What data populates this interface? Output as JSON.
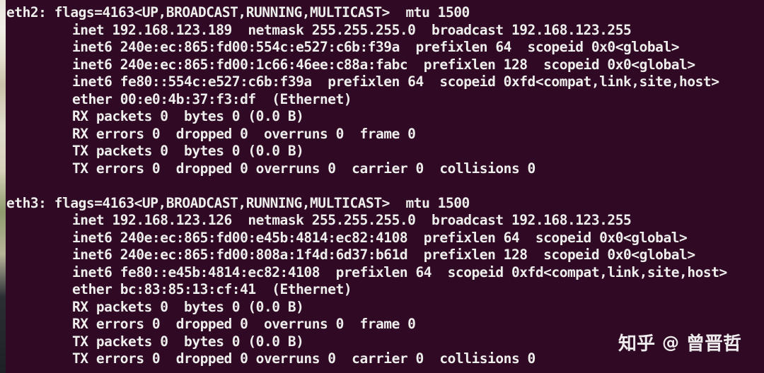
{
  "terminal": {
    "background": "#300a24",
    "foreground": "#eeeeec",
    "eth2": {
      "header": "eth2: flags=4163<UP,BROADCAST,RUNNING,MULTICAST>  mtu 1500",
      "lines": [
        "inet 192.168.123.189  netmask 255.255.255.0  broadcast 192.168.123.255",
        "inet6 240e:ec:865:fd00:554c:e527:c6b:f39a  prefixlen 64  scopeid 0x0<global>",
        "inet6 240e:ec:865:fd00:1c66:46ee:c88a:fabc  prefixlen 128  scopeid 0x0<global>",
        "inet6 fe80::554c:e527:c6b:f39a  prefixlen 64  scopeid 0xfd<compat,link,site,host>",
        "ether 00:e0:4b:37:f3:df  (Ethernet)",
        "RX packets 0  bytes 0 (0.0 B)",
        "RX errors 0  dropped 0  overruns 0  frame 0",
        "TX packets 0  bytes 0 (0.0 B)",
        "TX errors 0  dropped 0 overruns 0  carrier 0  collisions 0"
      ]
    },
    "eth3": {
      "header": "eth3: flags=4163<UP,BROADCAST,RUNNING,MULTICAST>  mtu 1500",
      "lines": [
        "inet 192.168.123.126  netmask 255.255.255.0  broadcast 192.168.123.255",
        "inet6 240e:ec:865:fd00:e45b:4814:ec82:4108  prefixlen 64  scopeid 0x0<global>",
        "inet6 240e:ec:865:fd00:808a:1f4d:6d37:b61d  prefixlen 128  scopeid 0x0<global>",
        "inet6 fe80::e45b:4814:ec82:4108  prefixlen 64  scopeid 0xfd<compat,link,site,host>",
        "ether bc:83:85:13:cf:41  (Ethernet)",
        "RX packets 0  bytes 0 (0.0 B)",
        "RX errors 0  dropped 0  overruns 0  frame 0",
        "TX packets 0  bytes 0 (0.0 B)",
        "TX errors 0  dropped 0 overruns 0  carrier 0  collisions 0"
      ]
    }
  },
  "watermark": {
    "brand": "知乎",
    "at": "@",
    "user": "曾晋哲"
  }
}
